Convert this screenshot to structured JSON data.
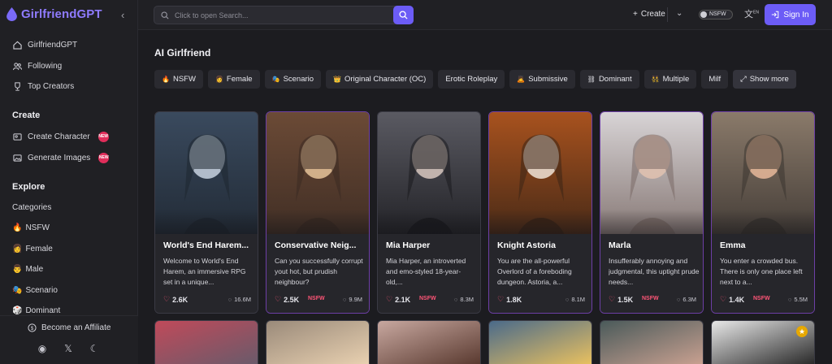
{
  "brand": {
    "name": "GirlfriendGPT",
    "accent": "#6c5cf6"
  },
  "sidebar": {
    "top_items": [
      {
        "label": "GirlfriendGPT",
        "icon": "home-icon"
      },
      {
        "label": "Following",
        "icon": "people-icon"
      },
      {
        "label": "Top Creators",
        "icon": "trophy-icon"
      }
    ],
    "create_title": "Create",
    "create_items": [
      {
        "label": "Create Character",
        "badge": "NEW"
      },
      {
        "label": "Generate Images",
        "badge": "NEW"
      }
    ],
    "explore_title": "Explore",
    "categories_label": "Categories",
    "categories": [
      {
        "emoji": "🔥",
        "label": "NSFW"
      },
      {
        "emoji": "👩",
        "label": "Female"
      },
      {
        "emoji": "👨",
        "label": "Male"
      },
      {
        "emoji": "🎭",
        "label": "Scenario"
      },
      {
        "emoji": "🎲",
        "label": "Dominant"
      }
    ],
    "affiliate_label": "Become an Affiliate"
  },
  "topbar": {
    "search_placeholder": "Click to open Search...",
    "create_label": "Create",
    "nsfw_toggle_label": "NSFW",
    "lang_badge": "EN",
    "signin_label": "Sign In"
  },
  "main": {
    "title": "AI Girlfriend",
    "chips": [
      {
        "emoji": "🔥",
        "label": "NSFW"
      },
      {
        "emoji": "👩",
        "label": "Female"
      },
      {
        "emoji": "🎭",
        "label": "Scenario"
      },
      {
        "emoji": "👑",
        "label": "Original Character (OC)"
      },
      {
        "emoji": "",
        "label": "Erotic Roleplay"
      },
      {
        "emoji": "🙇",
        "label": "Submissive"
      },
      {
        "emoji": "⛓",
        "label": "Dominant"
      },
      {
        "emoji": "👯",
        "label": "Multiple"
      },
      {
        "emoji": "",
        "label": "Milf"
      }
    ],
    "show_more_label": "Show more",
    "cards": [
      {
        "name": "World's End Harem...",
        "desc": "Welcome to World's End Harem, an immersive RPG set in a unique...",
        "likes": "2.6K",
        "nsfw": "",
        "chats": "16.6M",
        "palette": [
          "#3a4a5e",
          "#1e2630",
          "#c8d4e0"
        ]
      },
      {
        "name": "Conservative Neig...",
        "desc": "Can you successfully corrupt yout hot, but prudish neighbour?",
        "likes": "2.5K",
        "nsfw": "NSFW",
        "chats": "9.9M",
        "palette": [
          "#6b4a36",
          "#3a2a22",
          "#e8c49a"
        ]
      },
      {
        "name": "Mia Harper",
        "desc": "Mia Harper, an introverted and emo-styled 18-year-old,...",
        "likes": "2.1K",
        "nsfw": "NSFW",
        "chats": "8.3M",
        "palette": [
          "#5a5a62",
          "#1a1a1e",
          "#d8c8c0"
        ]
      },
      {
        "name": "Knight Astoria",
        "desc": "You are the all-powerful Overlord of a foreboding dungeon. Astoria, a...",
        "likes": "1.8K",
        "nsfw": "",
        "chats": "8.1M",
        "palette": [
          "#a8521e",
          "#3a2416",
          "#f0e4d8"
        ]
      },
      {
        "name": "Marla",
        "desc": "Insufferably annoying and judgmental, this uptight prude needs...",
        "likes": "1.5K",
        "nsfw": "NSFW",
        "chats": "6.3M",
        "palette": [
          "#d8d4d6",
          "#7a6a66",
          "#e2c2b0"
        ]
      },
      {
        "name": "Emma",
        "desc": "You enter a crowded bus. There is only one place left next to a...",
        "likes": "1.4K",
        "nsfw": "NSFW",
        "chats": "5.5M",
        "palette": [
          "#8a7a6a",
          "#3a3430",
          "#e8b89a"
        ]
      }
    ],
    "peek_cards": [
      {
        "palette": [
          "#c04a5a",
          "#6a5a6a"
        ]
      },
      {
        "palette": [
          "#9a8a7a",
          "#e8d0b0"
        ]
      },
      {
        "palette": [
          "#c8a8a0",
          "#5a3a30"
        ]
      },
      {
        "palette": [
          "#4a6a8a",
          "#e8c060"
        ]
      },
      {
        "palette": [
          "#4a5a5a",
          "#c8a090"
        ]
      },
      {
        "palette": [
          "#e8e8e8",
          "#2a2a2a"
        ]
      }
    ]
  }
}
